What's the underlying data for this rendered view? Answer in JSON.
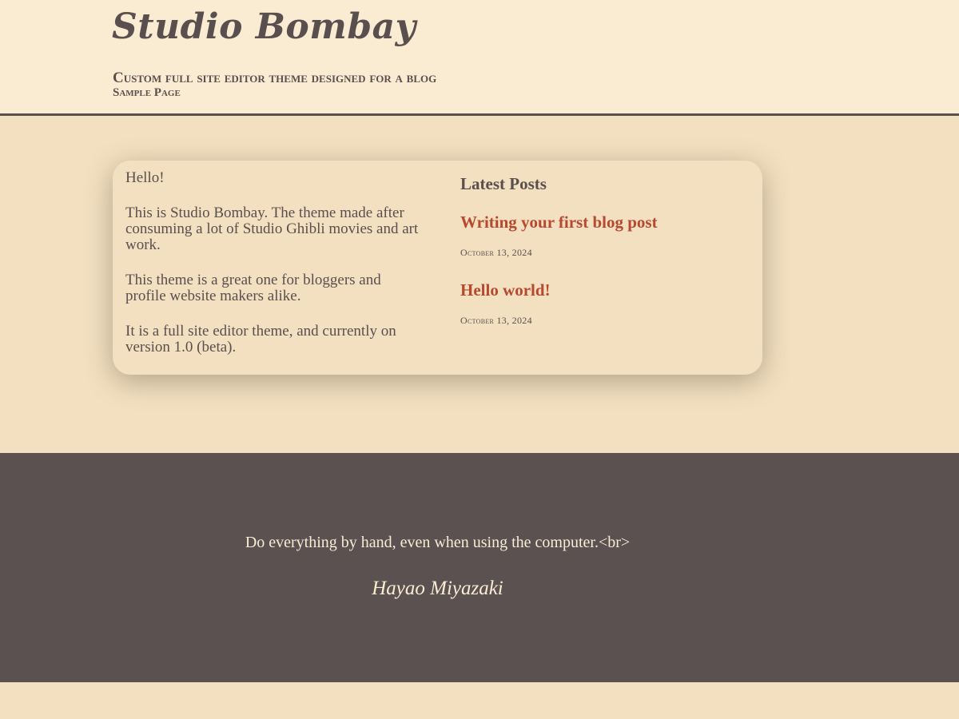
{
  "header": {
    "site_title": "Studio Bombay",
    "tagline": "Custom full site editor theme designed for a blog",
    "nav": [
      {
        "label": "Sample Page"
      }
    ]
  },
  "content": {
    "intro_paragraphs": [
      "Hello!",
      "This is Studio Bombay. The theme made after consuming a lot of Studio Ghibli movies and art work.",
      "This theme is a great one for bloggers and profile website makers alike.",
      "It is a full site editor theme, and currently on version 1.0 (beta)."
    ],
    "latest_posts": {
      "heading": "Latest Posts",
      "posts": [
        {
          "title": "Writing your first blog post",
          "date": "October 13, 2024"
        },
        {
          "title": "Hello world!",
          "date": "October 13, 2024"
        }
      ]
    }
  },
  "footer": {
    "quote": "Do everything by hand, even when using the computer.<br>",
    "author": "Hayao Miyazaki"
  },
  "colors": {
    "page_background": "#f2e0c0",
    "header_background": "#faecd3",
    "text": "#5a4f4f",
    "link": "#b6492f",
    "footer_background": "#5a5150",
    "footer_text": "#faecd3"
  }
}
